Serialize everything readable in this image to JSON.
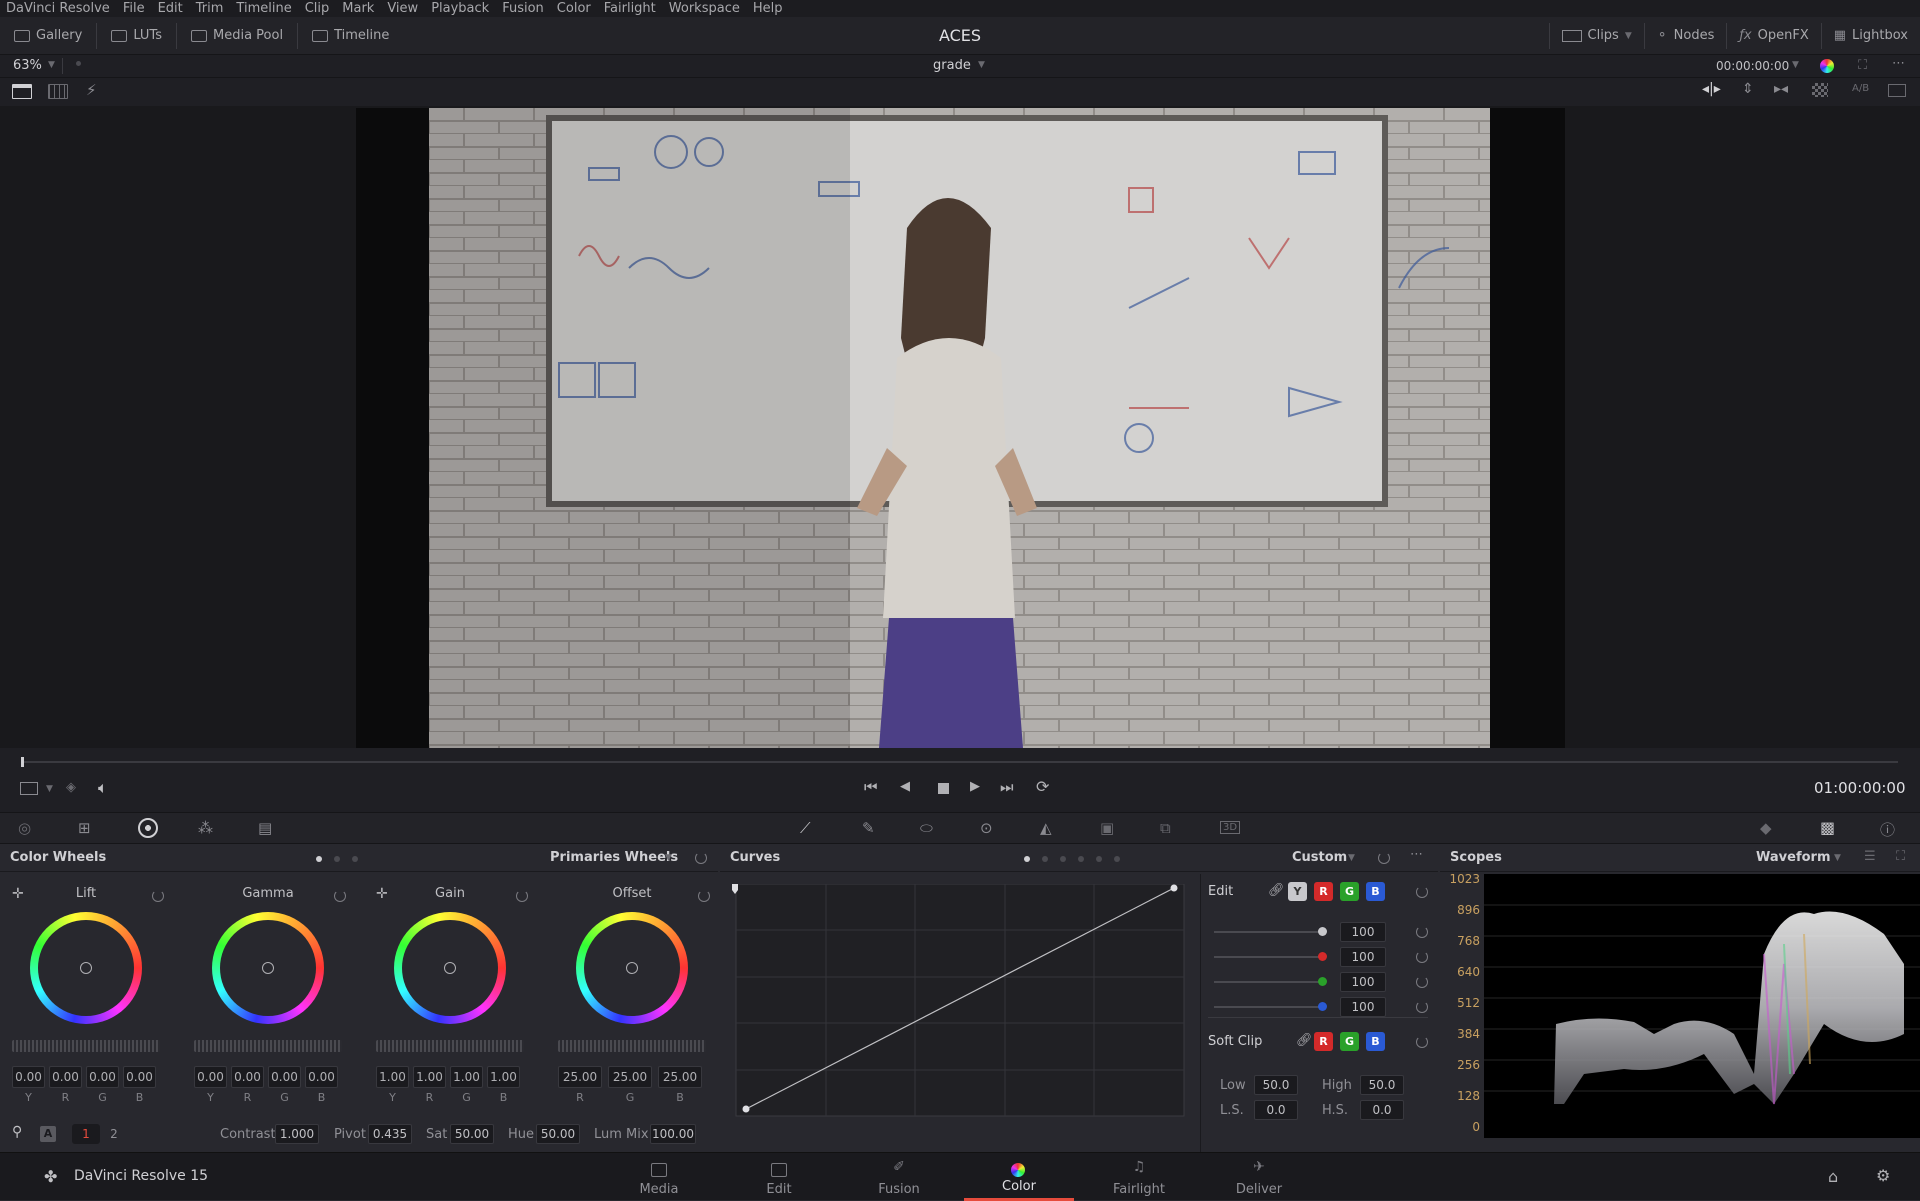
{
  "menu": [
    "DaVinci Resolve",
    "File",
    "Edit",
    "Trim",
    "Timeline",
    "Clip",
    "Mark",
    "View",
    "Playback",
    "Fusion",
    "Color",
    "Fairlight",
    "Workspace",
    "Help"
  ],
  "toolbar": {
    "left": [
      "Gallery",
      "LUTs",
      "Media Pool",
      "Timeline"
    ],
    "title": "ACES",
    "right": [
      "Clips",
      "Nodes",
      "OpenFX",
      "Lightbox"
    ]
  },
  "viewer": {
    "zoom": "63%",
    "clip_name": "grade",
    "timecode_top": "00:00:00:00",
    "timecode": "01:00:00:00",
    "wipe_label": "A/B"
  },
  "color_wheels": {
    "title": "Color Wheels",
    "mode": "Primaries Wheels",
    "wheels": [
      {
        "name": "Lift",
        "values": [
          "0.00",
          "0.00",
          "0.00",
          "0.00"
        ],
        "channels": [
          "Y",
          "R",
          "G",
          "B"
        ]
      },
      {
        "name": "Gamma",
        "values": [
          "0.00",
          "0.00",
          "0.00",
          "0.00"
        ],
        "channels": [
          "Y",
          "R",
          "G",
          "B"
        ]
      },
      {
        "name": "Gain",
        "values": [
          "1.00",
          "1.00",
          "1.00",
          "1.00"
        ],
        "channels": [
          "Y",
          "R",
          "G",
          "B"
        ]
      },
      {
        "name": "Offset",
        "values": [
          "25.00",
          "25.00",
          "25.00"
        ],
        "channels": [
          "R",
          "G",
          "B"
        ]
      }
    ],
    "pages": [
      "1",
      "2"
    ],
    "auto_label": "A",
    "contrast": {
      "label": "Contrast",
      "value": "1.000"
    },
    "pivot": {
      "label": "Pivot",
      "value": "0.435"
    },
    "sat": {
      "label": "Sat",
      "value": "50.00"
    },
    "hue": {
      "label": "Hue",
      "value": "50.00"
    },
    "lummix": {
      "label": "Lum Mix",
      "value": "100.00"
    }
  },
  "curves": {
    "title": "Curves",
    "mode": "Custom",
    "edit_label": "Edit",
    "channels": [
      "Y",
      "R",
      "G",
      "B"
    ],
    "intensities": [
      "100",
      "100",
      "100",
      "100"
    ],
    "softclip_label": "Soft Clip",
    "low": {
      "label": "Low",
      "value": "50.0"
    },
    "high": {
      "label": "High",
      "value": "50.0"
    },
    "ls": {
      "label": "L.S.",
      "value": "0.0"
    },
    "hs": {
      "label": "H.S.",
      "value": "0.0"
    }
  },
  "scopes": {
    "title": "Scopes",
    "mode": "Waveform",
    "ticks": [
      "1023",
      "896",
      "768",
      "640",
      "512",
      "384",
      "256",
      "128",
      "0"
    ]
  },
  "nav": {
    "app": "DaVinci Resolve 15",
    "pages": [
      "Media",
      "Edit",
      "Fusion",
      "Color",
      "Fairlight",
      "Deliver"
    ],
    "active": "Color"
  },
  "colors": {
    "accent": "#e64b3c",
    "red": "#d42a2a",
    "green": "#2aa12a",
    "blue": "#2a5ad4"
  }
}
